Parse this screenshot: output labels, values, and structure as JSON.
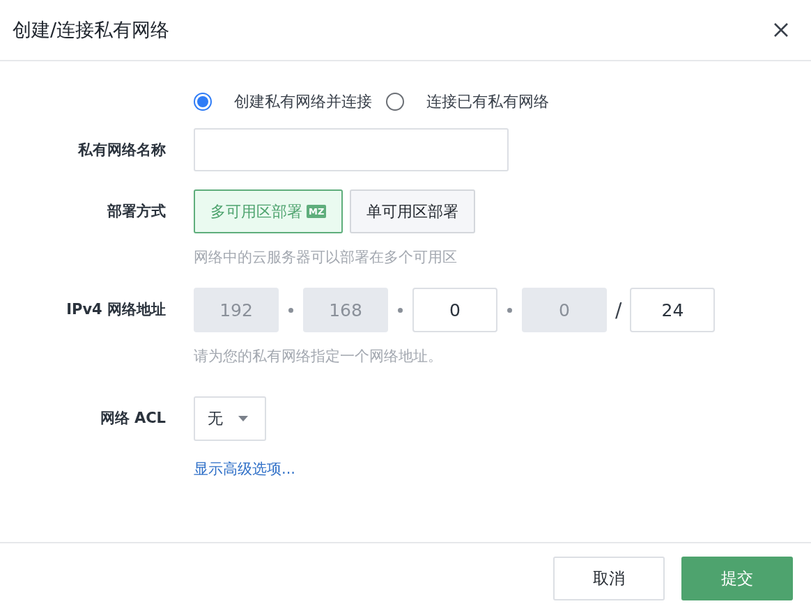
{
  "dialog": {
    "title": "创建/连接私有网络"
  },
  "mode_options": [
    {
      "label": "创建私有网络并连接",
      "selected": true
    },
    {
      "label": "连接已有私有网络",
      "selected": false
    }
  ],
  "name_field": {
    "label": "私有网络名称"
  },
  "deployment": {
    "label": "部署方式",
    "options": [
      {
        "label": "多可用区部署",
        "badge": "MZ",
        "selected": true
      },
      {
        "label": "单可用区部署",
        "selected": false
      }
    ],
    "hint": "网络中的云服务器可以部署在多个可用区"
  },
  "ipv4": {
    "label": "IPv4 网络地址",
    "octets": [
      {
        "value": "192",
        "disabled": true
      },
      {
        "value": "168",
        "disabled": true
      },
      {
        "value": "0",
        "disabled": false
      },
      {
        "value": "0",
        "disabled": true
      }
    ],
    "prefix_separator": "/",
    "prefix": {
      "value": "24",
      "disabled": false
    },
    "hint": "请为您的私有网络指定一个网络地址。"
  },
  "acl": {
    "label": "网络 ACL",
    "value": "无"
  },
  "advanced_link": "显示高级选项...",
  "buttons": [
    {
      "label": "取消",
      "kind": "secondary"
    },
    {
      "label": "提交",
      "kind": "primary"
    }
  ]
}
